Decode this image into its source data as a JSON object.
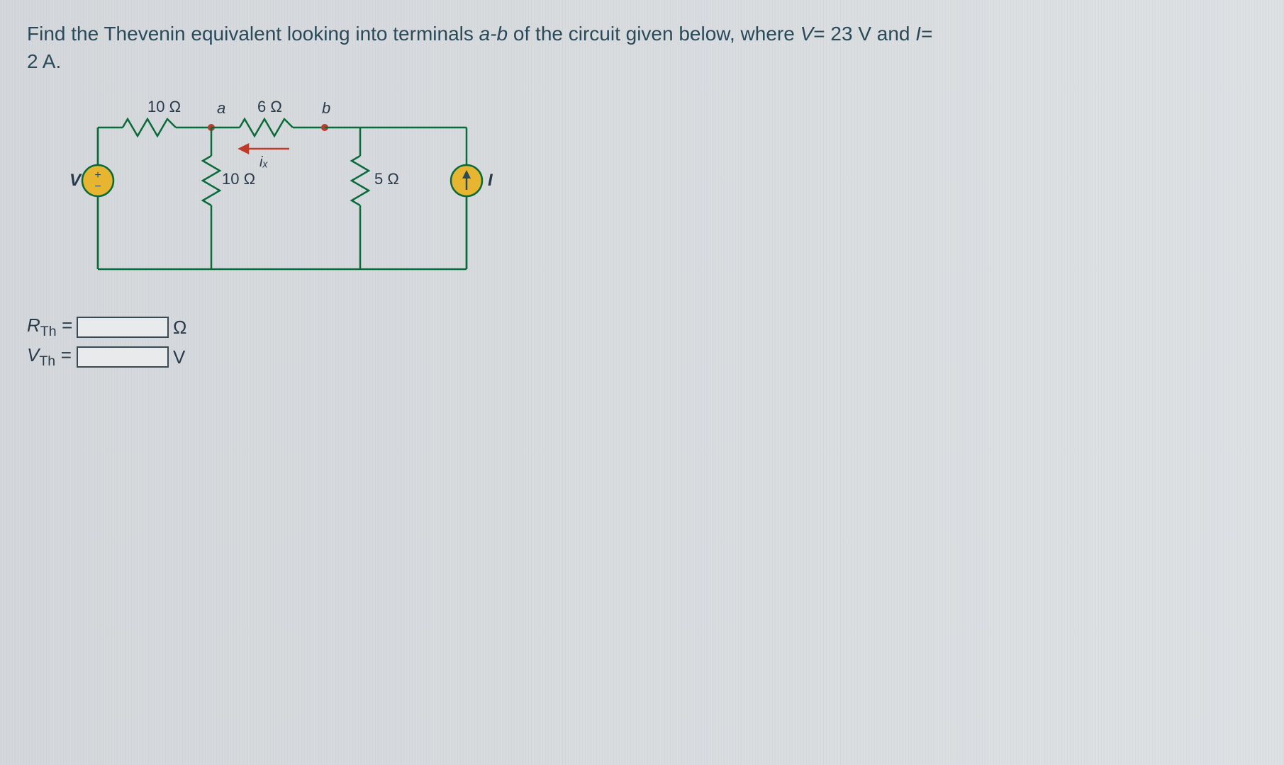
{
  "question": {
    "line1_prefix": "Find the Thevenin equivalent looking into terminals ",
    "terminals": "a-b ",
    "line1_mid": "of the circuit given below, where ",
    "v_sym": "V",
    "v_eq": "= 23 V and ",
    "i_sym": "I",
    "i_eq": "=",
    "line2": "2 A."
  },
  "circuit": {
    "labels": {
      "r_top_left": "10 Ω",
      "r_top_right": "6 Ω",
      "r_mid": "10 Ω",
      "r_right": "5 Ω",
      "v_src": "V",
      "i_src": "I",
      "node_a": "a",
      "node_b": "b",
      "ix": "iₓ"
    }
  },
  "answers": {
    "rth_label": "R",
    "rth_sub": "Th",
    "rth_eq": " =",
    "rth_unit": "Ω",
    "vth_label": "V",
    "vth_sub": "Th",
    "vth_eq": " =",
    "vth_unit": "V"
  }
}
